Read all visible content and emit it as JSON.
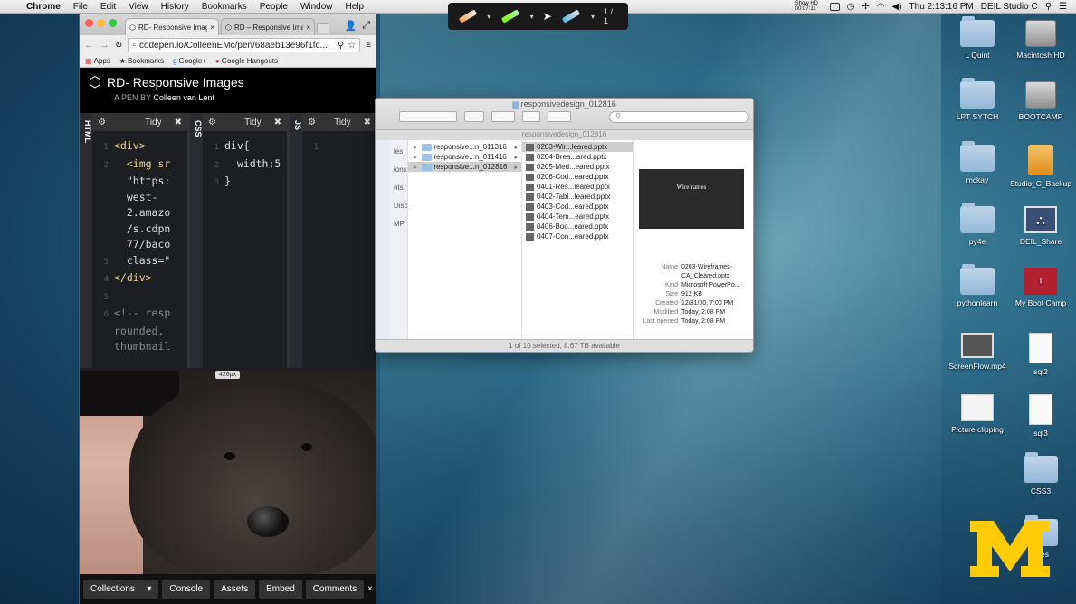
{
  "menubar": {
    "app": "Chrome",
    "items": [
      "File",
      "Edit",
      "View",
      "History",
      "Bookmarks",
      "People",
      "Window",
      "Help"
    ],
    "hd_text": "Show HD 00:07:11",
    "clock": "Thu 2:13:16 PM",
    "user": "DEIL Studio C"
  },
  "annotation_toolbar": {
    "page": "1 / 1"
  },
  "browser": {
    "tabs": [
      {
        "label": "RD- Responsive Imag"
      },
      {
        "label": "RD – Responsive Imag"
      }
    ],
    "url": "codepen.io/ColleenEMc/pen/68aeb13e96f1fc...",
    "bookmarks": [
      "Apps",
      "Bookmarks",
      "Google+",
      "Google Hangouts"
    ]
  },
  "codepen": {
    "title": "RD- Responsive Images",
    "by_prefix": "A PEN BY",
    "author": "Colleen van Lent",
    "panes": [
      {
        "label": "HTML",
        "tidy": "Tidy"
      },
      {
        "label": "CSS",
        "tidy": "Tidy"
      },
      {
        "label": "JS",
        "tidy": "Tidy"
      }
    ],
    "html_code": [
      {
        "n": "1",
        "t": "<div>"
      },
      {
        "n": "2",
        "t": "  <img sr"
      },
      {
        "n": "",
        "t": "  \"https:"
      },
      {
        "n": "",
        "t": "  west-"
      },
      {
        "n": "",
        "t": "  2.amazo"
      },
      {
        "n": "",
        "t": "  /s.cdpn"
      },
      {
        "n": "",
        "t": "  77/baco"
      },
      {
        "n": "3",
        "t": "  class=\""
      },
      {
        "n": "4",
        "t": "</div>"
      },
      {
        "n": "5",
        "t": ""
      },
      {
        "n": "6",
        "t": "<!-- resp"
      },
      {
        "n": "",
        "t": "rounded,"
      },
      {
        "n": "",
        "t": "thumbnail"
      }
    ],
    "css_code": [
      {
        "n": "1",
        "t": "div{"
      },
      {
        "n": "2",
        "t": "  width:5"
      },
      {
        "n": "3",
        "t": "}"
      }
    ],
    "js_code": [
      {
        "n": "1",
        "t": ""
      }
    ],
    "resize_label": "426px",
    "footer": [
      "Collections",
      "Console",
      "Assets",
      "Embed",
      "Comments"
    ]
  },
  "finder": {
    "title": "responsivedesign_012816",
    "path": "responsivedesign_012816",
    "sidebar_partial": [
      "les",
      "ions",
      "nts",
      "Disc",
      "MP"
    ],
    "folders": [
      {
        "name": "responsive...n_011316",
        "selected": false
      },
      {
        "name": "responsive...n_011416",
        "selected": false
      },
      {
        "name": "responsive...n_012816",
        "selected": true
      }
    ],
    "files": [
      {
        "name": "0203-Wir...leared.pptx",
        "selected": true
      },
      {
        "name": "0204-Brea...ared.pptx",
        "selected": false
      },
      {
        "name": "0205-Med...eared.pptx",
        "selected": false
      },
      {
        "name": "0206-Cod...eared.pptx",
        "selected": false
      },
      {
        "name": "0401-Res...leared.pptx",
        "selected": false
      },
      {
        "name": "0402-Tabl...leared.pptx",
        "selected": false
      },
      {
        "name": "0403-Cod...eared.pptx",
        "selected": false
      },
      {
        "name": "0404-Tem...eared.pptx",
        "selected": false
      },
      {
        "name": "0406-Boo...eared.pptx",
        "selected": false
      },
      {
        "name": "0407-Con...eared.pptx",
        "selected": false
      }
    ],
    "preview_title": "Wireframes",
    "meta": [
      {
        "k": "Name",
        "v": "0203-Wireframes-CA_Cleared.pptx"
      },
      {
        "k": "Kind",
        "v": "Microsoft PowerPo..."
      },
      {
        "k": "Size",
        "v": "912 KB"
      },
      {
        "k": "Created",
        "v": "12/31/00, 7:00 PM"
      },
      {
        "k": "Modified",
        "v": "Today, 2:08 PM"
      },
      {
        "k": "Last opened",
        "v": "Today, 2:08 PM"
      }
    ],
    "status": "1 of 10 selected, 8.67 TB available"
  },
  "desktop_icons": [
    {
      "label": "L Quint",
      "type": "folder"
    },
    {
      "label": "Macintosh HD",
      "type": "disk"
    },
    {
      "label": "LPT SYTCH",
      "type": "folder"
    },
    {
      "label": "BOOTCAMP",
      "type": "disk"
    },
    {
      "label": "mckay",
      "type": "folder"
    },
    {
      "label": "Studio_C_Backup",
      "type": "usb"
    },
    {
      "label": "py4e",
      "type": "folder"
    },
    {
      "label": "DEIL_Share",
      "type": "share"
    },
    {
      "label": "pythonlearn",
      "type": "folder"
    },
    {
      "label": "My Boot Camp",
      "type": "parallels"
    },
    {
      "label": "ScreenFlow.mp4",
      "type": "thumb"
    },
    {
      "label": "sql2",
      "type": "doc"
    },
    {
      "label": "Picture clipping",
      "type": "clip"
    },
    {
      "label": "sql3",
      "type": "doc"
    },
    {
      "label": "CSS3",
      "type": "folder"
    },
    {
      "label": "Files",
      "type": "folder"
    }
  ],
  "colors": {
    "michigan_maize": "#ffcb05",
    "michigan_blue": "#00274c",
    "codepen_bg": "#1d1e22"
  }
}
